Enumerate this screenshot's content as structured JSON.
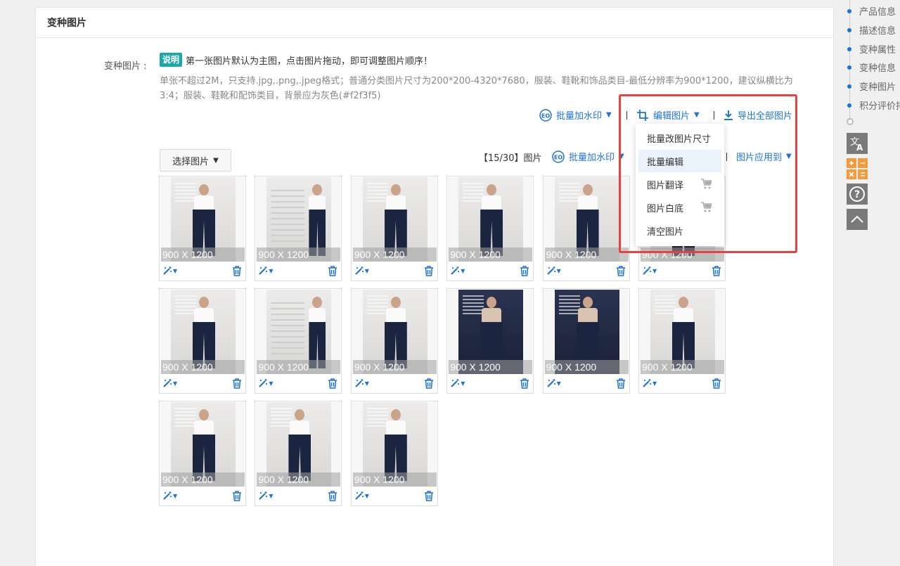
{
  "section": {
    "title": "变种图片"
  },
  "field": {
    "label": "变种图片 :"
  },
  "note": {
    "badge": "说明",
    "text": "第一张图片默认为主图，点击图片拖动，即可调整图片顺序！",
    "desc": "单张不超过2M，只支持.jpg,.png,.jpeg格式；普通分类图片尺寸为200*200-4320*7680，服装、鞋靴和饰品类目-最低分辨率为900*1200，建议纵横比为3:4；服装、鞋靴和配饰类目，背景应为灰色(#f2f3f5)"
  },
  "toolbar_top": {
    "watermark": "批量加水印",
    "edit": "编辑图片",
    "export": "导出全部图片"
  },
  "toolbar_main": {
    "select": "选择图片",
    "count": "【15/30】图片",
    "watermark": "批量加水印",
    "apply": "图片应用到"
  },
  "edit_menu": {
    "items": [
      "批量改图片尺寸",
      "批量编辑",
      "图片翻译",
      "图片白底",
      "清空图片"
    ]
  },
  "images": {
    "size_label": "900 X 1200",
    "count": 15
  },
  "nav": {
    "items": [
      "产品信息",
      "描述信息",
      "变种属性",
      "变种信息",
      "变种图片",
      "积分评价排"
    ]
  },
  "colors": {
    "accent": "#1e73d4",
    "badge": "#1aa8a8",
    "highlight": "#e64340"
  }
}
